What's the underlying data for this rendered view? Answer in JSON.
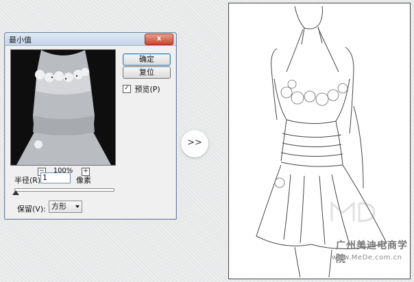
{
  "dialog": {
    "title": "最小值",
    "close_label": "x",
    "ok_label": "确定",
    "reset_label": "复位",
    "preview_label": "预览(P)",
    "preview_checked": true,
    "zoom_minus": "−",
    "zoom_plus": "+",
    "zoom_level": "100%",
    "radius_label": "半径(R):",
    "radius_value": "1",
    "radius_unit": "像素",
    "preserve_label": "保留(V):",
    "preserve_value": "方形"
  },
  "arrow": {
    "label": ">>"
  },
  "watermark": {
    "text": "广州美迪电商学院",
    "url": "www.MeDe.com.cn"
  },
  "colors": {
    "accent": "#3c7fb1",
    "close": "#c8452b"
  }
}
